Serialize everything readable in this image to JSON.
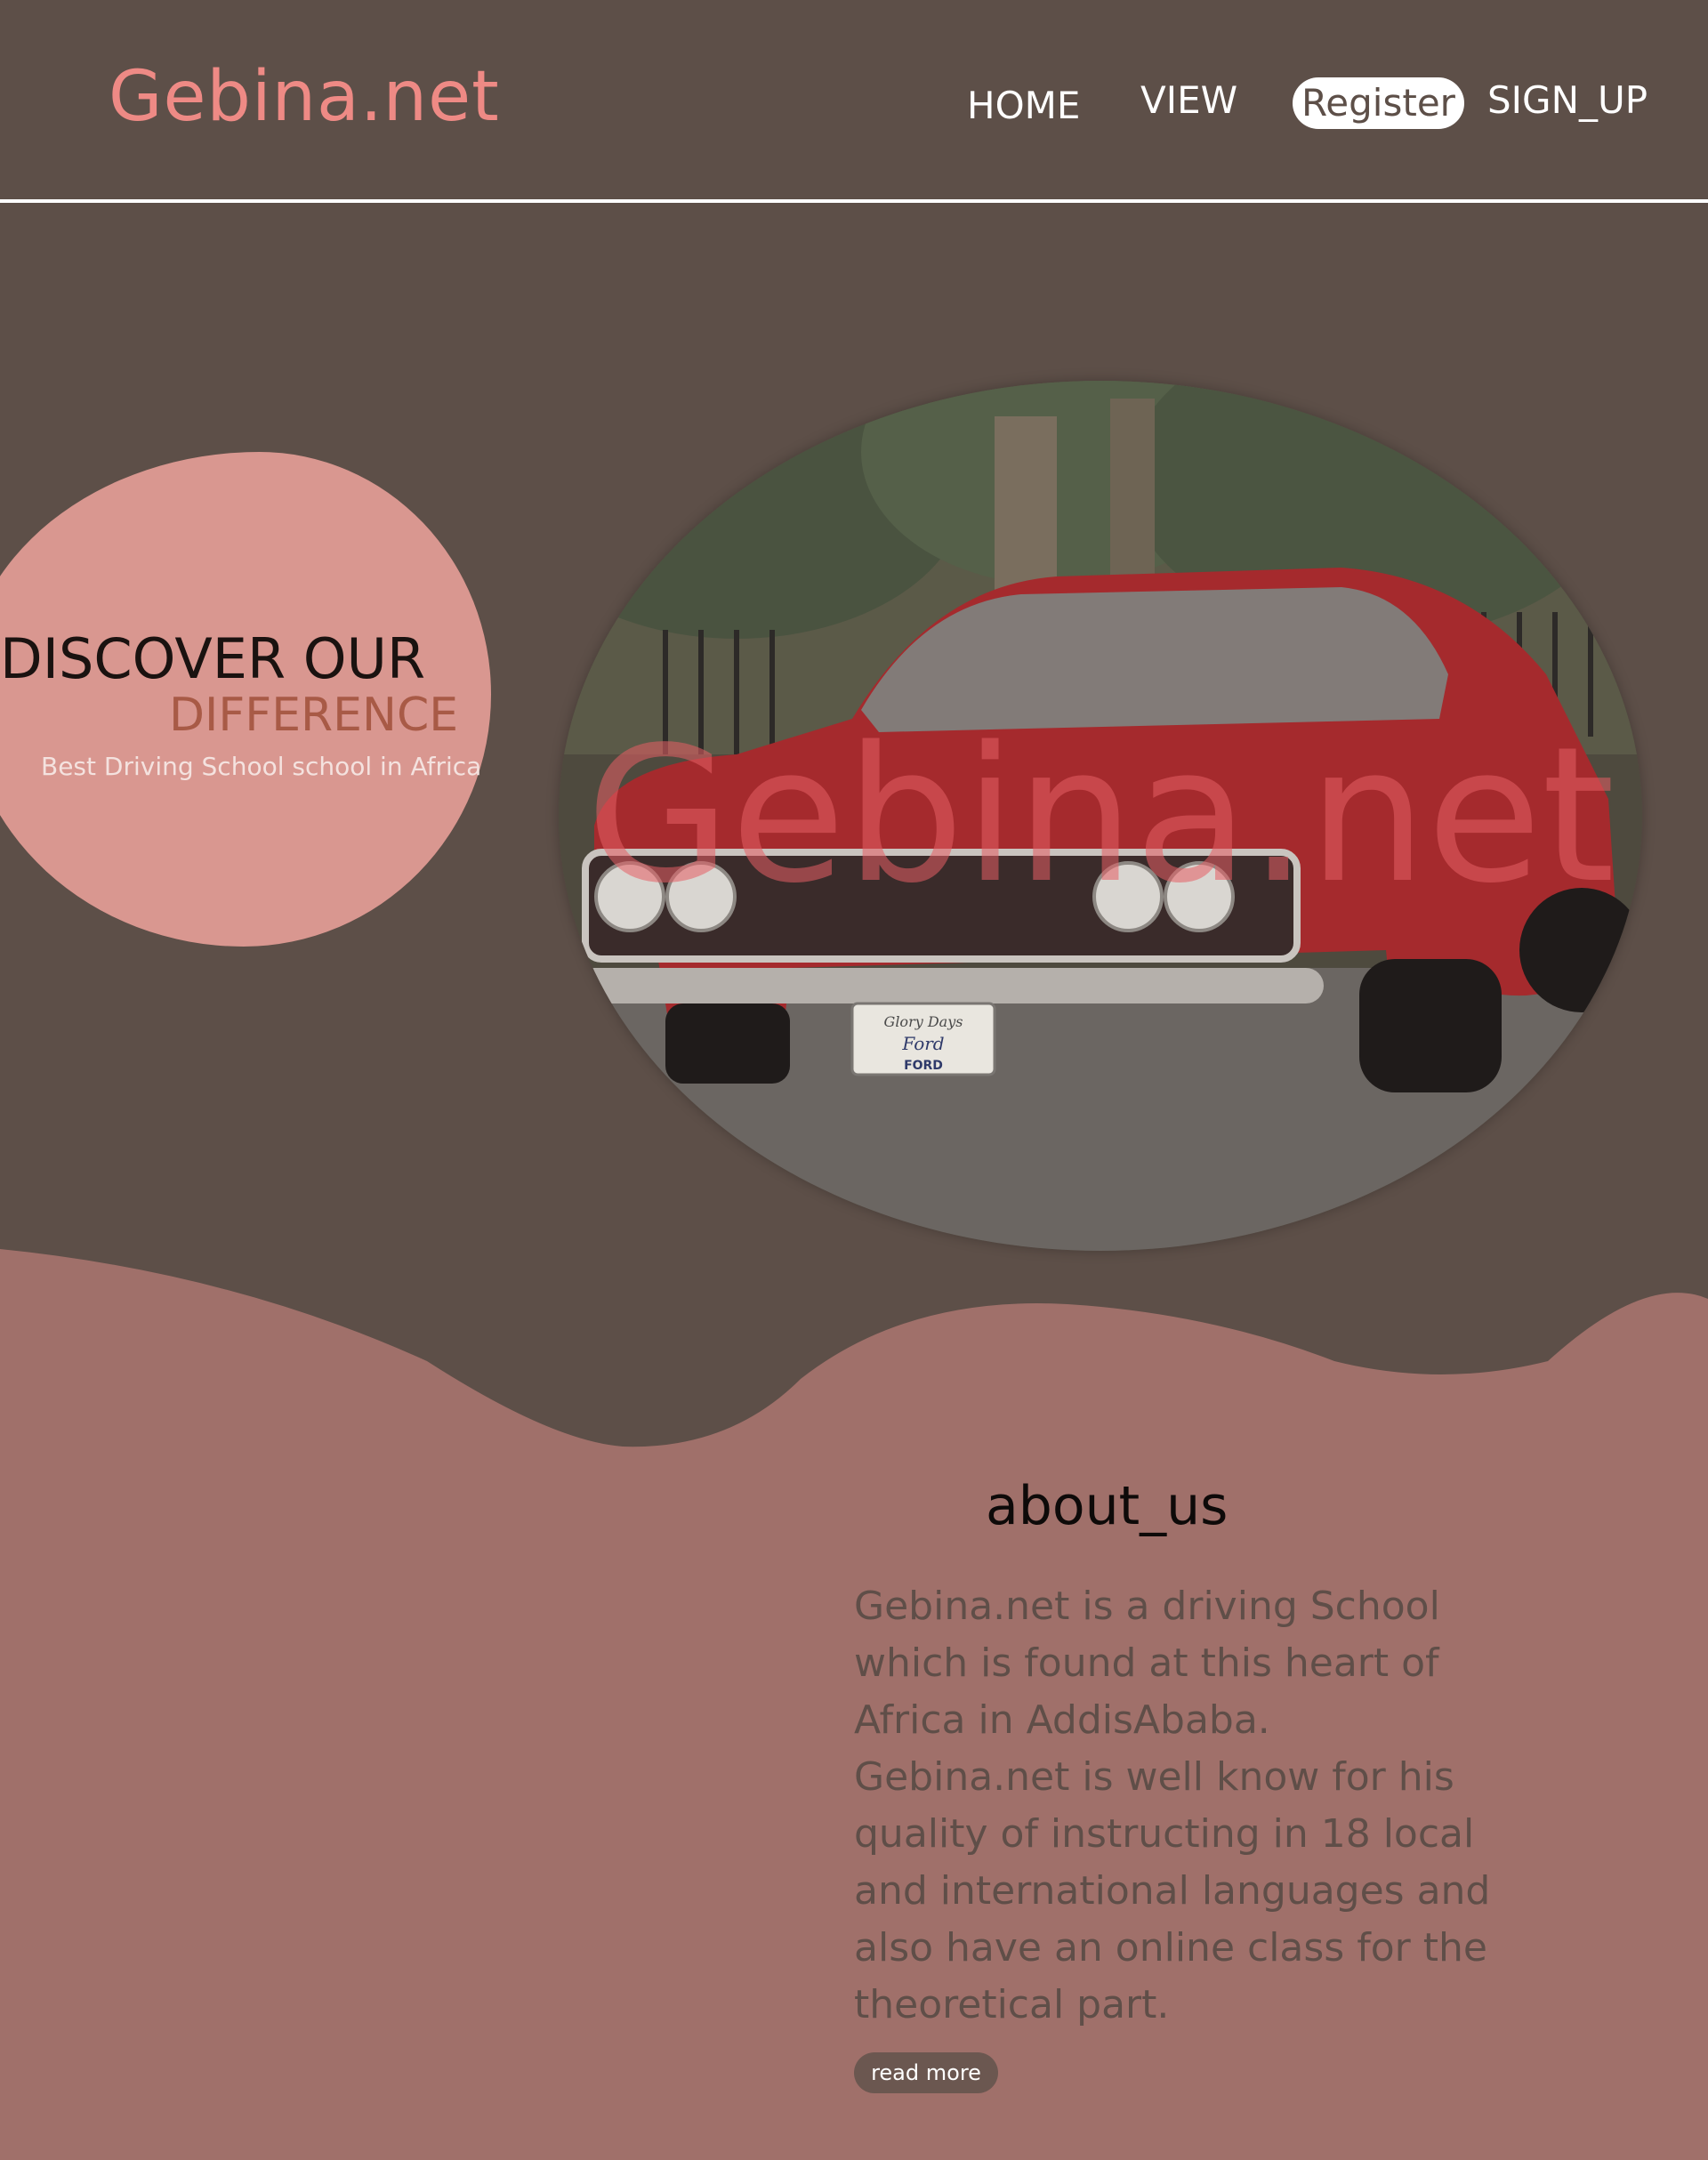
{
  "header": {
    "logo": "Gebina.net",
    "nav": [
      {
        "label": "HOME"
      },
      {
        "label": "VIEW"
      },
      {
        "label": "Register"
      },
      {
        "label": "SIGN_UP"
      }
    ]
  },
  "hero": {
    "title_line1": "DISCOVER OUR",
    "title_line2": "DIFFERENCE",
    "subtitle": "Best Driving School school in Africa",
    "image": {
      "subject": "red-classic-car",
      "watermark": "Gebina.net",
      "plate_line1": "Glory Days",
      "plate_line2": "Ford",
      "plate_line3": "FORD"
    }
  },
  "about": {
    "title": "about_us",
    "body": "Gebina.net is a driving School which is found at this heart of Africa in AddisAbaba. Gebina.net is well know for his quality of instructing in 18 local and international languages and also have an online class for the theoretical part.",
    "read_more": "read more"
  },
  "colors": {
    "background": "#5d4f48",
    "logo": "#ee8a85",
    "hero_blob": "#d99790",
    "accent": "#a85a46",
    "about_section": "#a0706a"
  }
}
